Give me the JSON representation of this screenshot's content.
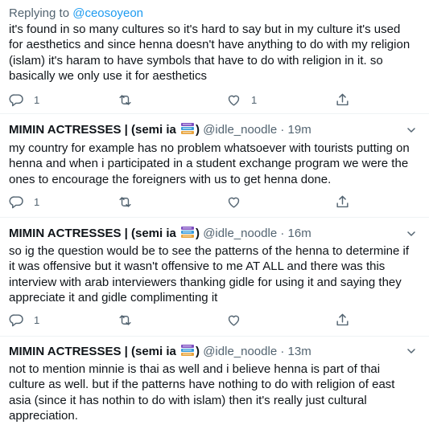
{
  "tweet0": {
    "reply_prefix": "Replying to",
    "reply_handle": "@ceosoyeon",
    "lines": [
      "it's found in so many cultures so it's hard to say but in my culture it's used",
      "for aesthetics and since henna doesn't have anything to do with my religion",
      "(islam) it's haram to have symbols that have to do with religion in it. so",
      "basically we only use it for aesthetics"
    ],
    "reply_count": "1",
    "like_count": "1"
  },
  "tweets": [
    {
      "name": "MIMIN ACTRESSES | (semi ia",
      "name_close": ")",
      "handle": "@idle_noodle",
      "dot": "·",
      "time": "19m",
      "lines": [
        "my country for example has no problem whatsoever with tourists putting on",
        "henna and when i participated in a student exchange program we were the",
        "ones to encourage the foreigners with us to get henna done."
      ],
      "reply_count": "1"
    },
    {
      "name": "MIMIN ACTRESSES | (semi ia",
      "name_close": ")",
      "handle": "@idle_noodle",
      "dot": "·",
      "time": "16m",
      "lines": [
        "so ig the question would be to see the patterns of the henna to determine if",
        "it was offensive but it wasn't offensive to me AT ALL and there was this",
        "interview with arab interviewers thanking gidle for using it and saying they",
        "appreciate it and gidle complimenting it"
      ],
      "reply_count": "1"
    },
    {
      "name": "MIMIN ACTRESSES | (semi ia",
      "name_close": ")",
      "handle": "@idle_noodle",
      "dot": "·",
      "time": "13m",
      "lines": [
        "not to mention minnie is thai as well and i believe henna is part of thai",
        "culture as well. but if the patterns have nothing to do with religion of east",
        "asia (since it has nothin to do with islam) then it's really just cultural",
        "appreciation."
      ]
    }
  ],
  "icons": {
    "reply": "reply-icon",
    "retweet": "retweet-icon",
    "like": "heart-icon",
    "share": "share-icon",
    "more": "chevron-down-icon",
    "name_emoji": "books-emoji-icon"
  },
  "colors": {
    "text": "#0f1419",
    "muted": "#536471",
    "link": "#1d9bf0"
  }
}
